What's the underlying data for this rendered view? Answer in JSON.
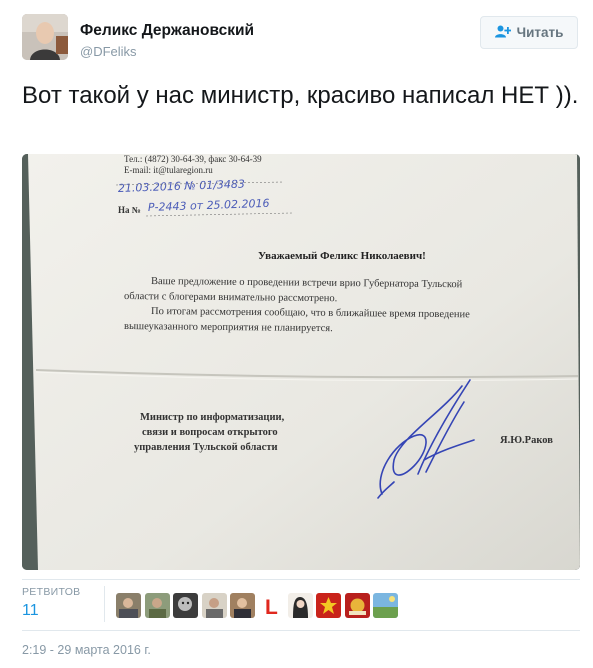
{
  "author": {
    "name": "Феликс Держановский",
    "handle": "@DFeliks"
  },
  "follow_button": {
    "label": "Читать",
    "icon": "add-user-icon"
  },
  "tweet": {
    "text": "Вот такой у нас министр, красиво написал НЕТ ))."
  },
  "photo": {
    "letter": {
      "phone": "Тел.: (4872) 30-64-39, факс 30-64-39",
      "email": "E-mail: it@tularegion.ru",
      "handwritten_date": "21.03.2016 № 01/3483",
      "ref_prefix": "На №",
      "handwritten_ref": "Р-2443 от 25.02.2016",
      "greeting": "Уважаемый Феликс Николаевич!",
      "para1_line1": "Ваше предложение о проведении встречи врио Губернатора Тульской",
      "para1_line2": "области с блогерами внимательно рассмотрено.",
      "para2_line1": "По итогам рассмотрения сообщаю, что в ближайшее время проведение",
      "para2_line2": "вышеуказанного мероприятия не планируется.",
      "sign_line1": "Министр по информатизации,",
      "sign_line2": "связи и вопросам открытого",
      "sign_line3": "управления Тульской области",
      "signer": "Я.Ю.Раков"
    }
  },
  "stats": {
    "retweets_label": "РЕТВИТОВ",
    "retweets_count": "11",
    "retweeter_avatar_count": 10,
    "colors": {
      "count": "#1b95e0",
      "red_letter": "#e0281e"
    },
    "letter_avatar": "L"
  },
  "timestamp": "2:19 - 29 марта 2016 г."
}
